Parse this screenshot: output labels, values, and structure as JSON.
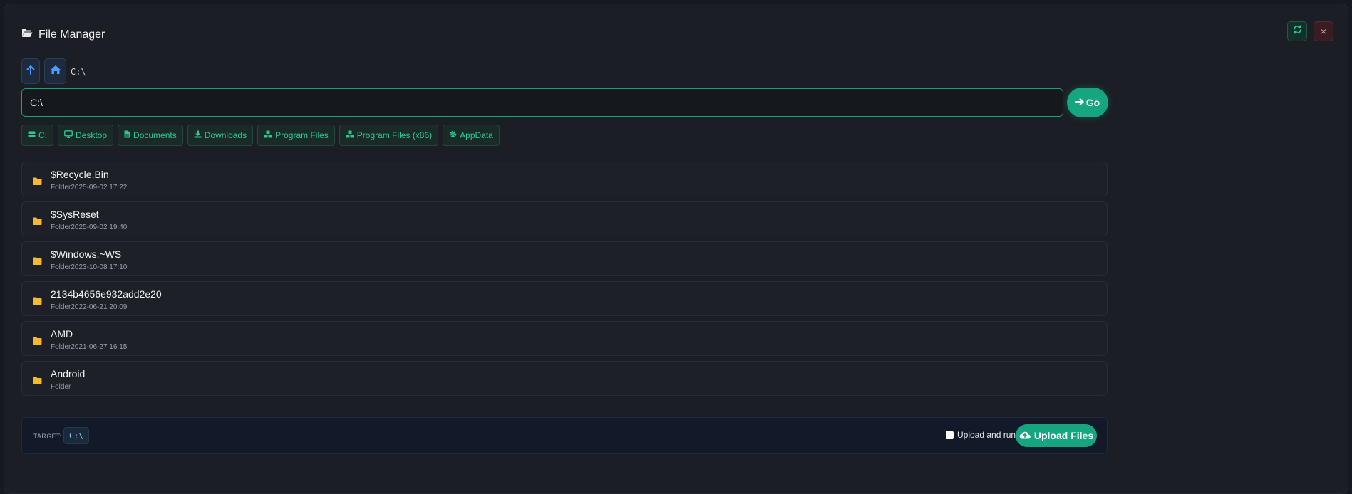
{
  "header": {
    "title": "File Manager",
    "icons": {
      "title": "folder-open-icon",
      "refresh": "refresh-icon",
      "close": "close-icon"
    },
    "close_label": "×"
  },
  "nav": {
    "up_icon": "arrow-up-icon",
    "home_icon": "home-icon",
    "current_path": "C:\\"
  },
  "path_input": {
    "value": "C:\\"
  },
  "go_button": {
    "label": "Go",
    "icon": "arrow-right-icon"
  },
  "quick_links": [
    {
      "label": "C:",
      "icon": "drive-icon"
    },
    {
      "label": "Desktop",
      "icon": "desktop-icon"
    },
    {
      "label": "Documents",
      "icon": "document-icon"
    },
    {
      "label": "Downloads",
      "icon": "download-icon"
    },
    {
      "label": "Program Files",
      "icon": "cubes-icon"
    },
    {
      "label": "Program Files (x86)",
      "icon": "cubes-icon"
    },
    {
      "label": "AppData",
      "icon": "gear-icon"
    }
  ],
  "files": [
    {
      "name": "$Recycle.Bin",
      "type": "Folder",
      "modified": "2025-09-02 17:22"
    },
    {
      "name": "$SysReset",
      "type": "Folder",
      "modified": "2025-09-02 19:40"
    },
    {
      "name": "$Windows.~WS",
      "type": "Folder",
      "modified": "2023-10-08 17:10"
    },
    {
      "name": "2134b4656e932add2e20",
      "type": "Folder",
      "modified": "2022-06-21 20:09"
    },
    {
      "name": "AMD",
      "type": "Folder",
      "modified": "2021-06-27 16:15"
    },
    {
      "name": "Android",
      "type": "Folder",
      "modified": ""
    }
  ],
  "footer": {
    "target_label": "TARGET:",
    "target_value": "C:\\",
    "checkbox_label": "Upload and run",
    "upload_label": "Upload Files",
    "upload_icon": "cloud-upload-icon"
  },
  "colors": {
    "accent": "#15a67f",
    "chip_text": "#2ec793",
    "folder": "#f5b82e",
    "nav_icon": "#4d9bff",
    "close": "#e0a9ae"
  }
}
